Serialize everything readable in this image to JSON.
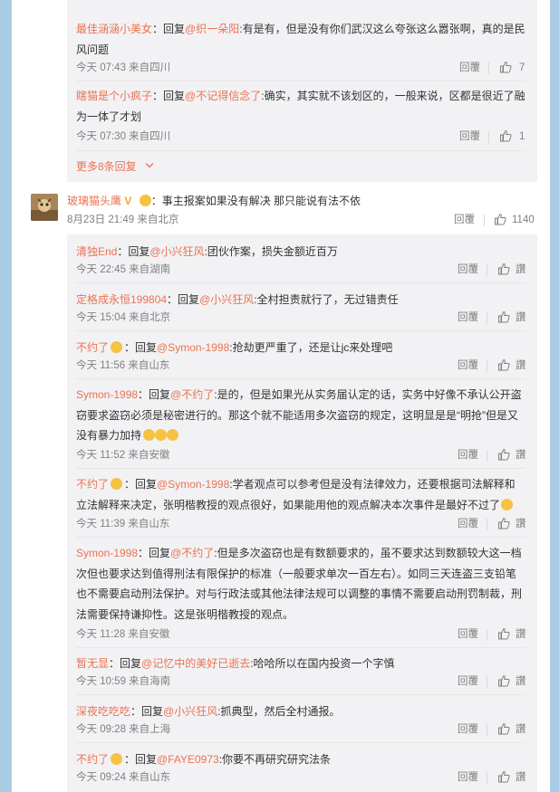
{
  "top_replies": [
    {
      "user": "最佳涵涵小美女",
      "sep": "：回复",
      "target": "@织一朵阳",
      "colon": ":",
      "text": "有是有，但是没有你们武汉这么夸张这么嚣张啊，真的是民风问题",
      "time": "今天 07:43 来自四川",
      "reply_label": "回覆",
      "likes": "7"
    },
    {
      "user": "瞎猫是个小疯子",
      "sep": "：回复",
      "target": "@不记得信念了",
      "colon": ":",
      "text": "确实，其实就不该划区的，一般来说，区都是很近了融为一体了才划",
      "time": "今天 07:30 来自四川",
      "reply_label": "回覆",
      "likes": "1"
    }
  ],
  "more_replies": "更多8条回复",
  "main_comment": {
    "user": "玻璃猫头鹰",
    "text": "：事主报案如果没有解决 那只能说有法不依",
    "time": "8月23日 21:49 来自北京",
    "reply_label": "回覆",
    "likes": "1140"
  },
  "replies": [
    {
      "user": "清独End",
      "sep": "：回复",
      "target": "@小兴狂风",
      "text": ":团伙作案，损失金额近百万",
      "time": "今天 22:45 来自湖南",
      "reply_label": "回覆",
      "like_label": "讚"
    },
    {
      "user": "定格成永恒199804",
      "sep": "：回复",
      "target": "@小兴狂风",
      "text": ":全村担责就行了，无过错责任",
      "time": "今天 15:04 来自北京",
      "reply_label": "回覆",
      "like_label": "讚"
    },
    {
      "user": "不约了",
      "sep": "：回复",
      "target": "@Symon-1998",
      "text": ":抢劫更严重了，还是让jc来处理吧",
      "time": "今天 11:56 来自山东",
      "reply_label": "回覆",
      "like_label": "讚"
    },
    {
      "user": "Symon-1998",
      "sep": "：回复",
      "target": "@不约了",
      "text": ":是的，但是如果光从实务届认定的话，实务中好像不承认公开盗窃要求盗窃必须是秘密进行的。那这个就不能适用多次盗窃的规定，这明显是是“明抢”但是又没有暴力加持",
      "time": "今天 11:52 来自安徽",
      "reply_label": "回覆",
      "like_label": "讚"
    },
    {
      "user": "不约了",
      "sep": "：回复",
      "target": "@Symon-1998",
      "text": ":学者观点可以参考但是没有法律效力，还要根据司法解释和立法解释来决定，张明楷教授的观点很好，如果能用他的观点解决本次事件是最好不过了",
      "time": "今天 11:39 来自山东",
      "reply_label": "回覆",
      "like_label": "讚"
    },
    {
      "user": "Symon-1998",
      "sep": "：回复",
      "target": "@不约了",
      "text": ":但是多次盗窃也是有数额要求的，虽不要求达到数额较大这一档次但也要求达到值得刑法有限保护的标准（一般要求单次一百左右）。如同三天连盗三支铅笔也不需要启动刑法保护。对与行政法或其他法律法规可以调整的事情不需要启动刑罚制裁，刑法需要保持谦抑性。这是张明楷教授的观点。",
      "time": "今天 11:28 来自安徽",
      "reply_label": "回覆",
      "like_label": "讚"
    },
    {
      "user": "暂无显",
      "sep": "：回复",
      "target": "@记忆中的美好已逝去",
      "text": ":哈哈所以在国内投资一个字慎",
      "time": "今天 10:59 来自海南",
      "reply_label": "回覆",
      "like_label": "讚"
    },
    {
      "user": "深夜吃吃吃",
      "sep": "：回复",
      "target": "@小兴狂风",
      "text": ":抓典型，然后全村通报。",
      "time": "今天 09:28 来自上海",
      "reply_label": "回覆",
      "like_label": "讚"
    },
    {
      "user": "不约了",
      "sep": "：回复",
      "target": "@FAYE0973",
      "text": ":你要不再研究研究法条",
      "time": "今天 09:24 来自山东",
      "reply_label": "回覆",
      "like_label": "讚"
    }
  ]
}
